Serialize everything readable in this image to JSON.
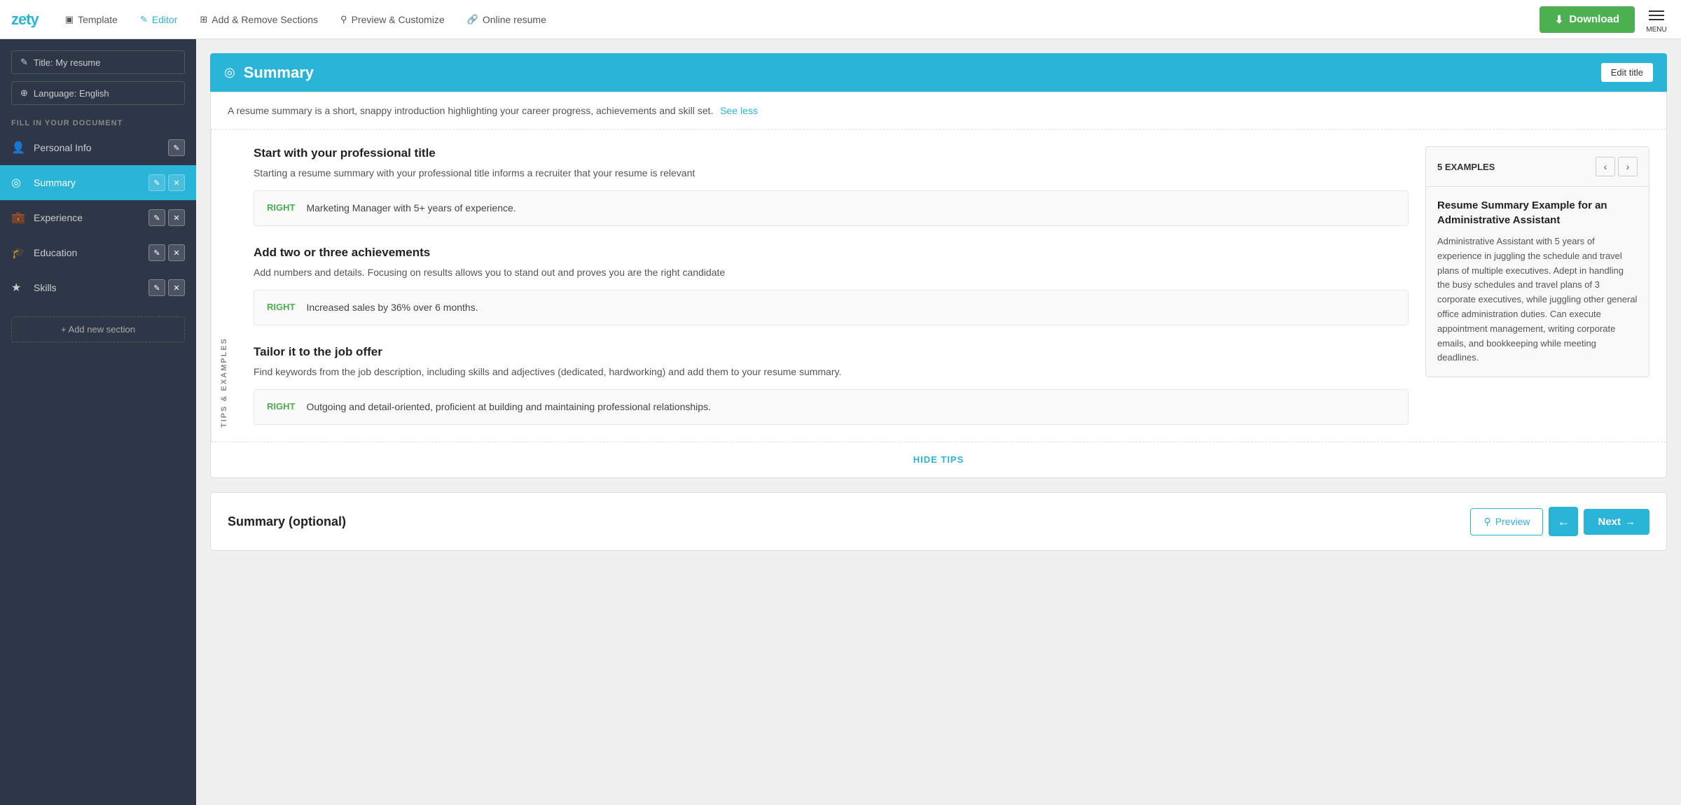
{
  "app": {
    "logo": "zety",
    "accent_color": "#2ab4d8",
    "green_color": "#4caf50"
  },
  "topnav": {
    "items": [
      {
        "id": "template",
        "label": "Template",
        "icon": "▣",
        "active": false
      },
      {
        "id": "editor",
        "label": "Editor",
        "icon": "✎",
        "active": true
      },
      {
        "id": "add-remove",
        "label": "Add & Remove Sections",
        "icon": "⊞",
        "active": false
      },
      {
        "id": "preview",
        "label": "Preview & Customize",
        "icon": "⚲",
        "active": false
      },
      {
        "id": "online",
        "label": "Online resume",
        "icon": "🔗",
        "active": false
      }
    ],
    "download_label": "Download",
    "menu_label": "MENU"
  },
  "sidebar": {
    "doc_title_btn": "Title: My resume",
    "doc_lang_btn": "Language: English",
    "fill_label": "FILL IN YOUR DOCUMENT",
    "nav_items": [
      {
        "id": "personal-info",
        "label": "Personal Info",
        "icon": "👤",
        "active": false,
        "has_actions": true
      },
      {
        "id": "summary",
        "label": "Summary",
        "icon": "◎",
        "active": true,
        "has_actions": true
      },
      {
        "id": "experience",
        "label": "Experience",
        "icon": "💼",
        "active": false,
        "has_actions": true
      },
      {
        "id": "education",
        "label": "Education",
        "icon": "🎓",
        "active": false,
        "has_actions": true
      },
      {
        "id": "skills",
        "label": "Skills",
        "icon": "★",
        "active": false,
        "has_actions": true
      }
    ],
    "add_section_label": "+ Add new section"
  },
  "section": {
    "icon": "◎",
    "title": "Summary",
    "edit_title_label": "Edit title",
    "intro_text": "A resume summary is a short, snappy introduction highlighting your career progress, achievements and skill set.",
    "see_less_label": "See less",
    "side_label": "TIPS & EXAMPLES",
    "tips": [
      {
        "id": "tip1",
        "title": "Start with your professional title",
        "desc": "Starting a resume summary with your professional title informs a recruiter that your resume is relevant",
        "example": "Marketing Manager with 5+ years of experience.",
        "right_label": "RIGHT"
      },
      {
        "id": "tip2",
        "title": "Add two or three achievements",
        "desc": "Add numbers and details. Focusing on results allows you to stand out and proves you are the right candidate",
        "example": "Increased sales by 36% over 6 months.",
        "right_label": "RIGHT"
      },
      {
        "id": "tip3",
        "title": "Tailor it to the job offer",
        "desc": "Find keywords from the job description, including skills and adjectives (dedicated, hardworking) and add them to your resume summary.",
        "example": "Outgoing and detail-oriented, proficient at building and maintaining professional relationships.",
        "right_label": "RIGHT"
      }
    ],
    "examples": {
      "count_label": "5 EXAMPLES",
      "example_title": "Resume Summary Example for an Administrative Assistant",
      "example_text": "Administrative Assistant with 5 years of experience in juggling the schedule and travel plans of multiple executives. Adept in handling the busy schedules and travel plans of 3 corporate executives, while juggling other general office administration duties. Can execute appointment management, writing corporate emails, and bookkeeping while meeting deadlines."
    },
    "hide_tips_label": "HIDE TIPS"
  },
  "bottom": {
    "summary_label": "Summary (optional)",
    "preview_label": "Preview",
    "next_label": "Next"
  }
}
